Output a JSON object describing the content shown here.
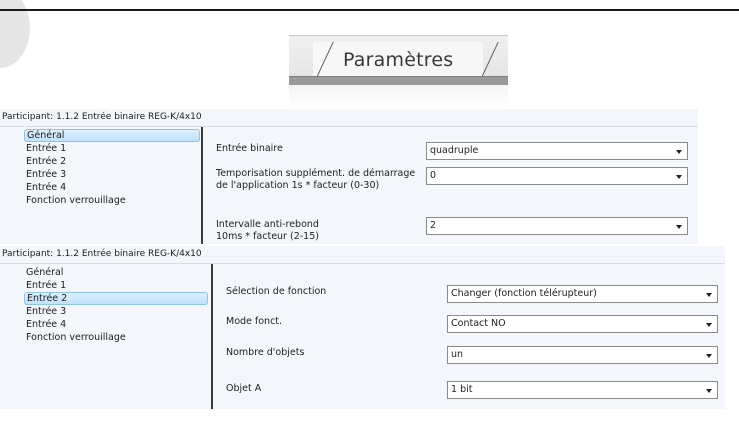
{
  "tab": {
    "label": "Paramètres"
  },
  "panel1": {
    "title": "Participant: 1.1.2  Entrée binaire REG-K/4x10",
    "sidebar": [
      {
        "label": "Général",
        "selected": true
      },
      {
        "label": "Entrée 1"
      },
      {
        "label": "Entrée 2"
      },
      {
        "label": "Entrée 3"
      },
      {
        "label": "Entrée 4"
      },
      {
        "label": "Fonction verrouillage"
      }
    ],
    "params": [
      {
        "label_lines": [
          "Entrée binaire"
        ],
        "value": "quadruple"
      },
      {
        "label_lines": [
          "Temporisation supplément. de démarrage",
          "de l'application 1s * facteur (0-30)"
        ],
        "value": "0"
      },
      {
        "label_lines": [
          "Intervalle anti-rebond",
          "10ms * facteur (2-15)"
        ],
        "value": "2"
      }
    ]
  },
  "panel2": {
    "title": "Participant: 1.1.2  Entrée binaire REG-K/4x10",
    "sidebar": [
      {
        "label": "Général"
      },
      {
        "label": "Entrée 1"
      },
      {
        "label": "Entrée 2",
        "selected": true
      },
      {
        "label": "Entrée 3"
      },
      {
        "label": "Entrée 4"
      },
      {
        "label": "Fonction verrouillage"
      }
    ],
    "params": [
      {
        "label_lines": [
          "Sélection de fonction"
        ],
        "value": "Changer (fonction télérupteur)"
      },
      {
        "label_lines": [
          "Mode fonct."
        ],
        "value": "Contact NO"
      },
      {
        "label_lines": [
          "Nombre d'objets"
        ],
        "value": "un"
      },
      {
        "label_lines": [
          "Objet A"
        ],
        "value": "1 bit"
      }
    ]
  }
}
